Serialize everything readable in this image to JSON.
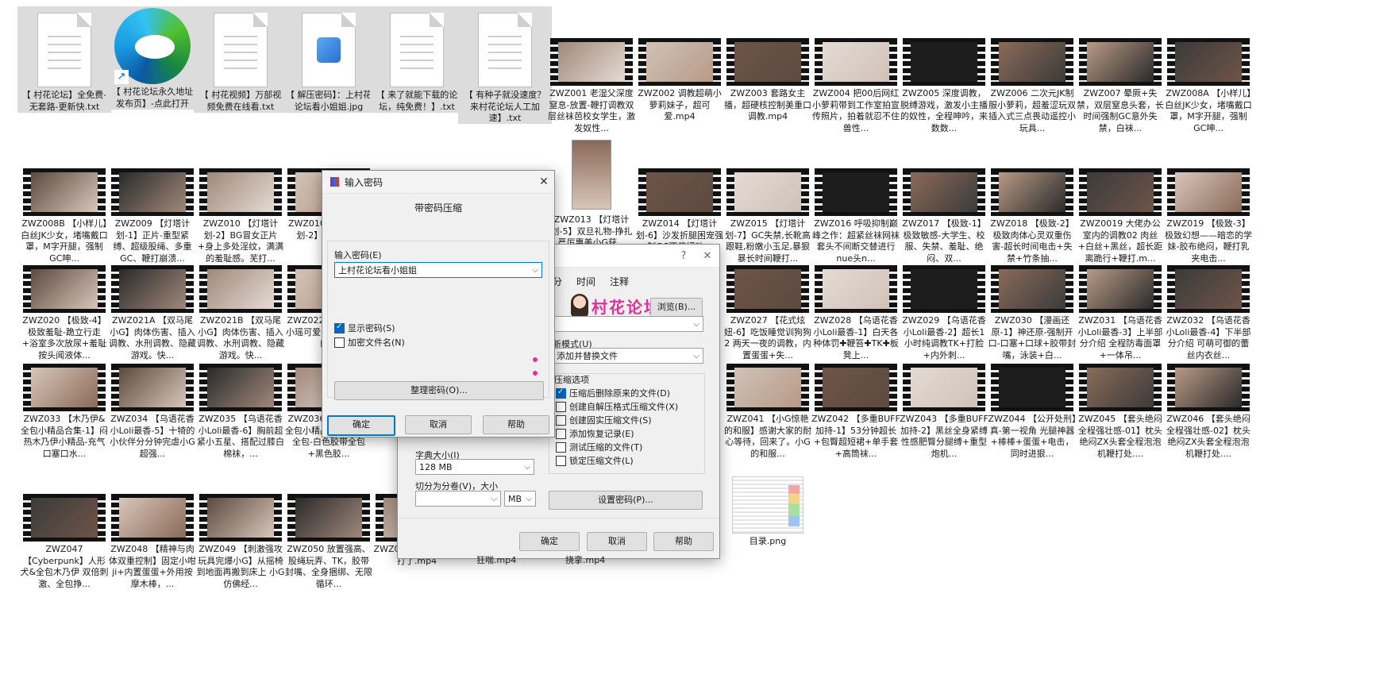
{
  "files": [
    {
      "type": "txt",
      "label": "【 村花论坛】全免费-无套路-更新快.txt",
      "selected": true
    },
    {
      "type": "edge",
      "label": "【 村花论坛永久地址发布页】-点此打开",
      "selected": true
    },
    {
      "type": "txt",
      "label": "【 村花视频】万部视频免费在线看.txt",
      "selected": true
    },
    {
      "type": "jpg",
      "label": "【 解压密码】：上村花论坛看小姐姐.jpg",
      "selected": true
    },
    {
      "type": "txt",
      "label": "【 来了就能下载的论坛，纯免费！】.txt",
      "selected": true
    },
    {
      "type": "txt",
      "label": "【 有种子就没速度？来村花论坛人工加速】.txt",
      "selected": true
    },
    {
      "type": "video",
      "label": "ZWZ001 老湿父深度窒息-放置-鞭打调教双层丝袜芭校女学生，激发奴性..."
    },
    {
      "type": "video",
      "label": "ZWZ002 调教超萌小萝莉妹子，超可爱.mp4"
    },
    {
      "type": "video",
      "label": "ZWZ003 套路女主播，超硬核控制美重口调教.mp4"
    },
    {
      "type": "video",
      "label": "ZWZ004 把00后网红小萝莉带到工作室拍宣传照片，拍着就忍不住兽性..."
    },
    {
      "type": "video",
      "label": "ZWZ005 深度调教，脱缚游戏，激发小主播的奴性，全程呻吟，来数数..."
    },
    {
      "type": "video",
      "label": "ZWZ006 二次元JK制服小萝莉，超羞涩玩双插入式三点畏动遥控小玩具..."
    },
    {
      "type": "video",
      "label": "ZWZ007 晕厥+失禁，双层窒息头套，长时间强制GC意外失禁，白袜..."
    },
    {
      "type": "video",
      "label": "ZWZ008A 【小样儿】白丝JK少女，堵嘴戴口罩，M字开腿，强制GC呻..."
    },
    {
      "type": "video",
      "label": "ZWZ013 【灯塔计划-5】双旦礼物-挣扎 严厉惠美小G获..."
    },
    {
      "type": "video",
      "label": "ZWZ008B 【小样儿】白丝JK少女，堵嘴戴口罩，M字开腿，强制GC呻..."
    },
    {
      "type": "video",
      "label": "ZWZ009 【灯塔计划-1】正片-重型紧缚、超级股绳、多重GC、鞭打崩溃..."
    },
    {
      "type": "video",
      "label": "ZWZ010 【灯塔计划-2】BG冒女正片+身上多处淫纹，满满的羞耻感。芜打..."
    },
    {
      "type": "video",
      "label": "ZWZ010C 【灯塔计划-2】BG花絮..."
    },
    {
      "type": "video",
      "label": "ZWZ014 【灯塔计划-6】沙发折腿困宠强制GC不停扭动..."
    },
    {
      "type": "video",
      "label": "ZWZ015 【灯塔计划-7】GC失禁,长靴高跟鞋,粉嫩小玉足,暴狠暴长时间鞭打..."
    },
    {
      "type": "video",
      "label": "ZWZ016 呼吸抑制巅峰之作：超紧丝袜网袜套头不间断交替进行 nue头n..."
    },
    {
      "type": "video",
      "label": "ZWZ017 【极致-1】极致敏感-大学生、校服、失禁、羞耻、绝闷、双..."
    },
    {
      "type": "video",
      "label": "ZWZ018 【极致-2】极致肉体心灵双重伤害-超长时间电击+失禁+竹条抽..."
    },
    {
      "type": "video",
      "label": "ZWZ0019 大佬办公室内的调教02 肉丝+白丝+黑丝，超长距离跪行+鞭打.m..."
    },
    {
      "type": "video",
      "label": "ZWZ019 【极致-3】极致幻想——暗恋的学妹-胶布绝闷，鞭打乳夹电击..."
    },
    {
      "type": "video",
      "label": "ZWZ020 【极致-4】极致羞耻-跪立行走+浴室多次放尿+羞耻按头闻液体..."
    },
    {
      "type": "video",
      "label": "ZWZ021A 【双马尾小G】肉体伤害、插入调教、水刑调教、隐藏游戏。快..."
    },
    {
      "type": "video",
      "label": "ZWZ021B 【双马尾小G】肉体伤害、插入调教、水刑调教、隐藏游戏。快..."
    },
    {
      "type": "video",
      "label": "ZWZ022 【...妞-1】小瑶可爱的小一样Q弹的..."
    },
    {
      "type": "video",
      "label": "ZWZ027 【花式炫妞-6】吃饭睡觉训狗狗2 两天一夜的调教，内置蛋蛋+失..."
    },
    {
      "type": "video",
      "label": "ZWZ028 【乌语花香 小Loli最香-1】白天各种体罚✚鞭笞✚TK✚板凳上..."
    },
    {
      "type": "video",
      "label": "ZWZ029 【乌语花香 小Loli最香-2】超长1小时纯调教TK+打脸+内外刺..."
    },
    {
      "type": "video",
      "label": "ZWZ030 【漫画还原-1】神还原-强制开口-口塞+口球+胶带封嘴，泳装+白..."
    },
    {
      "type": "video",
      "label": "ZWZ031 【乌语花香 小Loli最香-3】上半部分介绍 全程防毒面罩+一体吊..."
    },
    {
      "type": "video",
      "label": "ZWZ032 【乌语花香 小Loli最香-4】下半部分介绍 可萌可御的蕾丝内衣丝..."
    },
    {
      "type": "video",
      "label": "ZWZ033 【木乃伊&全包小精品合集-1】闷热木乃伊小精品-充气口塞口水..."
    },
    {
      "type": "video",
      "label": "ZWZ034 【乌语花香 小Loli最香-5】十犄的小伙伴分分钟完虐小G 超强..."
    },
    {
      "type": "video",
      "label": "ZWZ035 【乌语花香 小Loli最香-6】胸前超紧小五星、搭配过膝白棉袜，..."
    },
    {
      "type": "video",
      "label": "ZWZ036 【木乃伊&全包小精品-2】木乃伊全包-白色胶带全包+黑色胶..."
    },
    {
      "type": "video",
      "label": "ZWZ041 【小G惊艳的和服】感谢大家的耐心等待，回来了。小G的和服..."
    },
    {
      "type": "video",
      "label": "ZWZ042 【多重BUFF加持-1】53分钟超长+包臀超短裙+单手套+高筒袜..."
    },
    {
      "type": "video",
      "label": "ZWZ043 【多重BUFF加持-2】黑丝全身紧缚 性感肥臀分腿缚+重型炮机..."
    },
    {
      "type": "video",
      "label": "ZWZ044 【公开处刑】真-第一视角 光腿神器+棒棒+蛋蛋+电击，同时进狠..."
    },
    {
      "type": "video",
      "label": "ZWZ045 【套头绝闷全程强壮感-01】枕头绝闷ZX头套全程泡泡机鞭打处...."
    },
    {
      "type": "video",
      "label": "ZWZ046 【套头绝闷全程强壮感-02】枕头绝闷ZX头套全程泡泡机鞭打处...."
    },
    {
      "type": "video",
      "label": "ZWZ047 【Cyberpunk】人形犬&全包木乃伊 双倍刺激、全包挣..."
    },
    {
      "type": "video",
      "label": "ZWZ048 【精神与肉体双重控制】固定小咁ji+内置蛋蛋+外用按摩木棒，..."
    },
    {
      "type": "video",
      "label": "ZWZ049 【刺激强攻玩具完爆小G】从摇椅到地面再搬到床上 小G仿佛经..."
    },
    {
      "type": "video",
      "label": "ZWZ050 放置强高、股绳玩弄、TK，胶带封嘴、全身捆绑、无限循环..."
    },
    {
      "type": "video",
      "label": "ZWZ05... 袜小萝莉被打了.mp4"
    },
    {
      "type": "png",
      "label": "目录.png"
    }
  ],
  "back_dialog": {
    "tabs": [
      "分",
      "时间",
      "注释"
    ],
    "browse_label": "浏览(B)...",
    "update_mode_label": "新模式(U)",
    "update_mode_value": "添加并替换文件",
    "options_group": "压缩选项",
    "options": [
      {
        "label": "压缩后删除原来的文件(D)",
        "checked": true
      },
      {
        "label": "创建自解压格式压缩文件(X)",
        "checked": false
      },
      {
        "label": "创建固实压缩文件(S)",
        "checked": false
      },
      {
        "label": "添加恢复记录(E)",
        "checked": false
      },
      {
        "label": "测试压缩的文件(T)",
        "checked": false
      },
      {
        "label": "锁定压缩文件(L)",
        "checked": false
      }
    ],
    "dict_label": "字典大小(I)",
    "dict_value": "128 MB",
    "split_label": "切分为分卷(V)，大小",
    "split_unit": "MB",
    "set_password": "设置密码(P)...",
    "ok": "确定",
    "cancel": "取消",
    "help": "帮助",
    "watermark": "村花论坛",
    "help_glyph": "?",
    "close_glyph": "✕",
    "partial_files": [
      "狂喘.mp4",
      "挠挛.mp4"
    ]
  },
  "password_dialog": {
    "title": "输入密码",
    "subtitle": "带密码压缩",
    "password_label": "输入密码(E)",
    "password_value": "上村花论坛看小姐姐",
    "show_password": "显示密码(S)",
    "show_password_checked": true,
    "encrypt_names": "加密文件名(N)",
    "encrypt_names_checked": false,
    "organize": "整理密码(O)...",
    "ok": "确定",
    "cancel": "取消",
    "help": "帮助",
    "close_glyph": "✕"
  },
  "colors": {
    "selection": "#dcdcdc",
    "accent": "#0067c0",
    "watermark": "#e0309a"
  }
}
